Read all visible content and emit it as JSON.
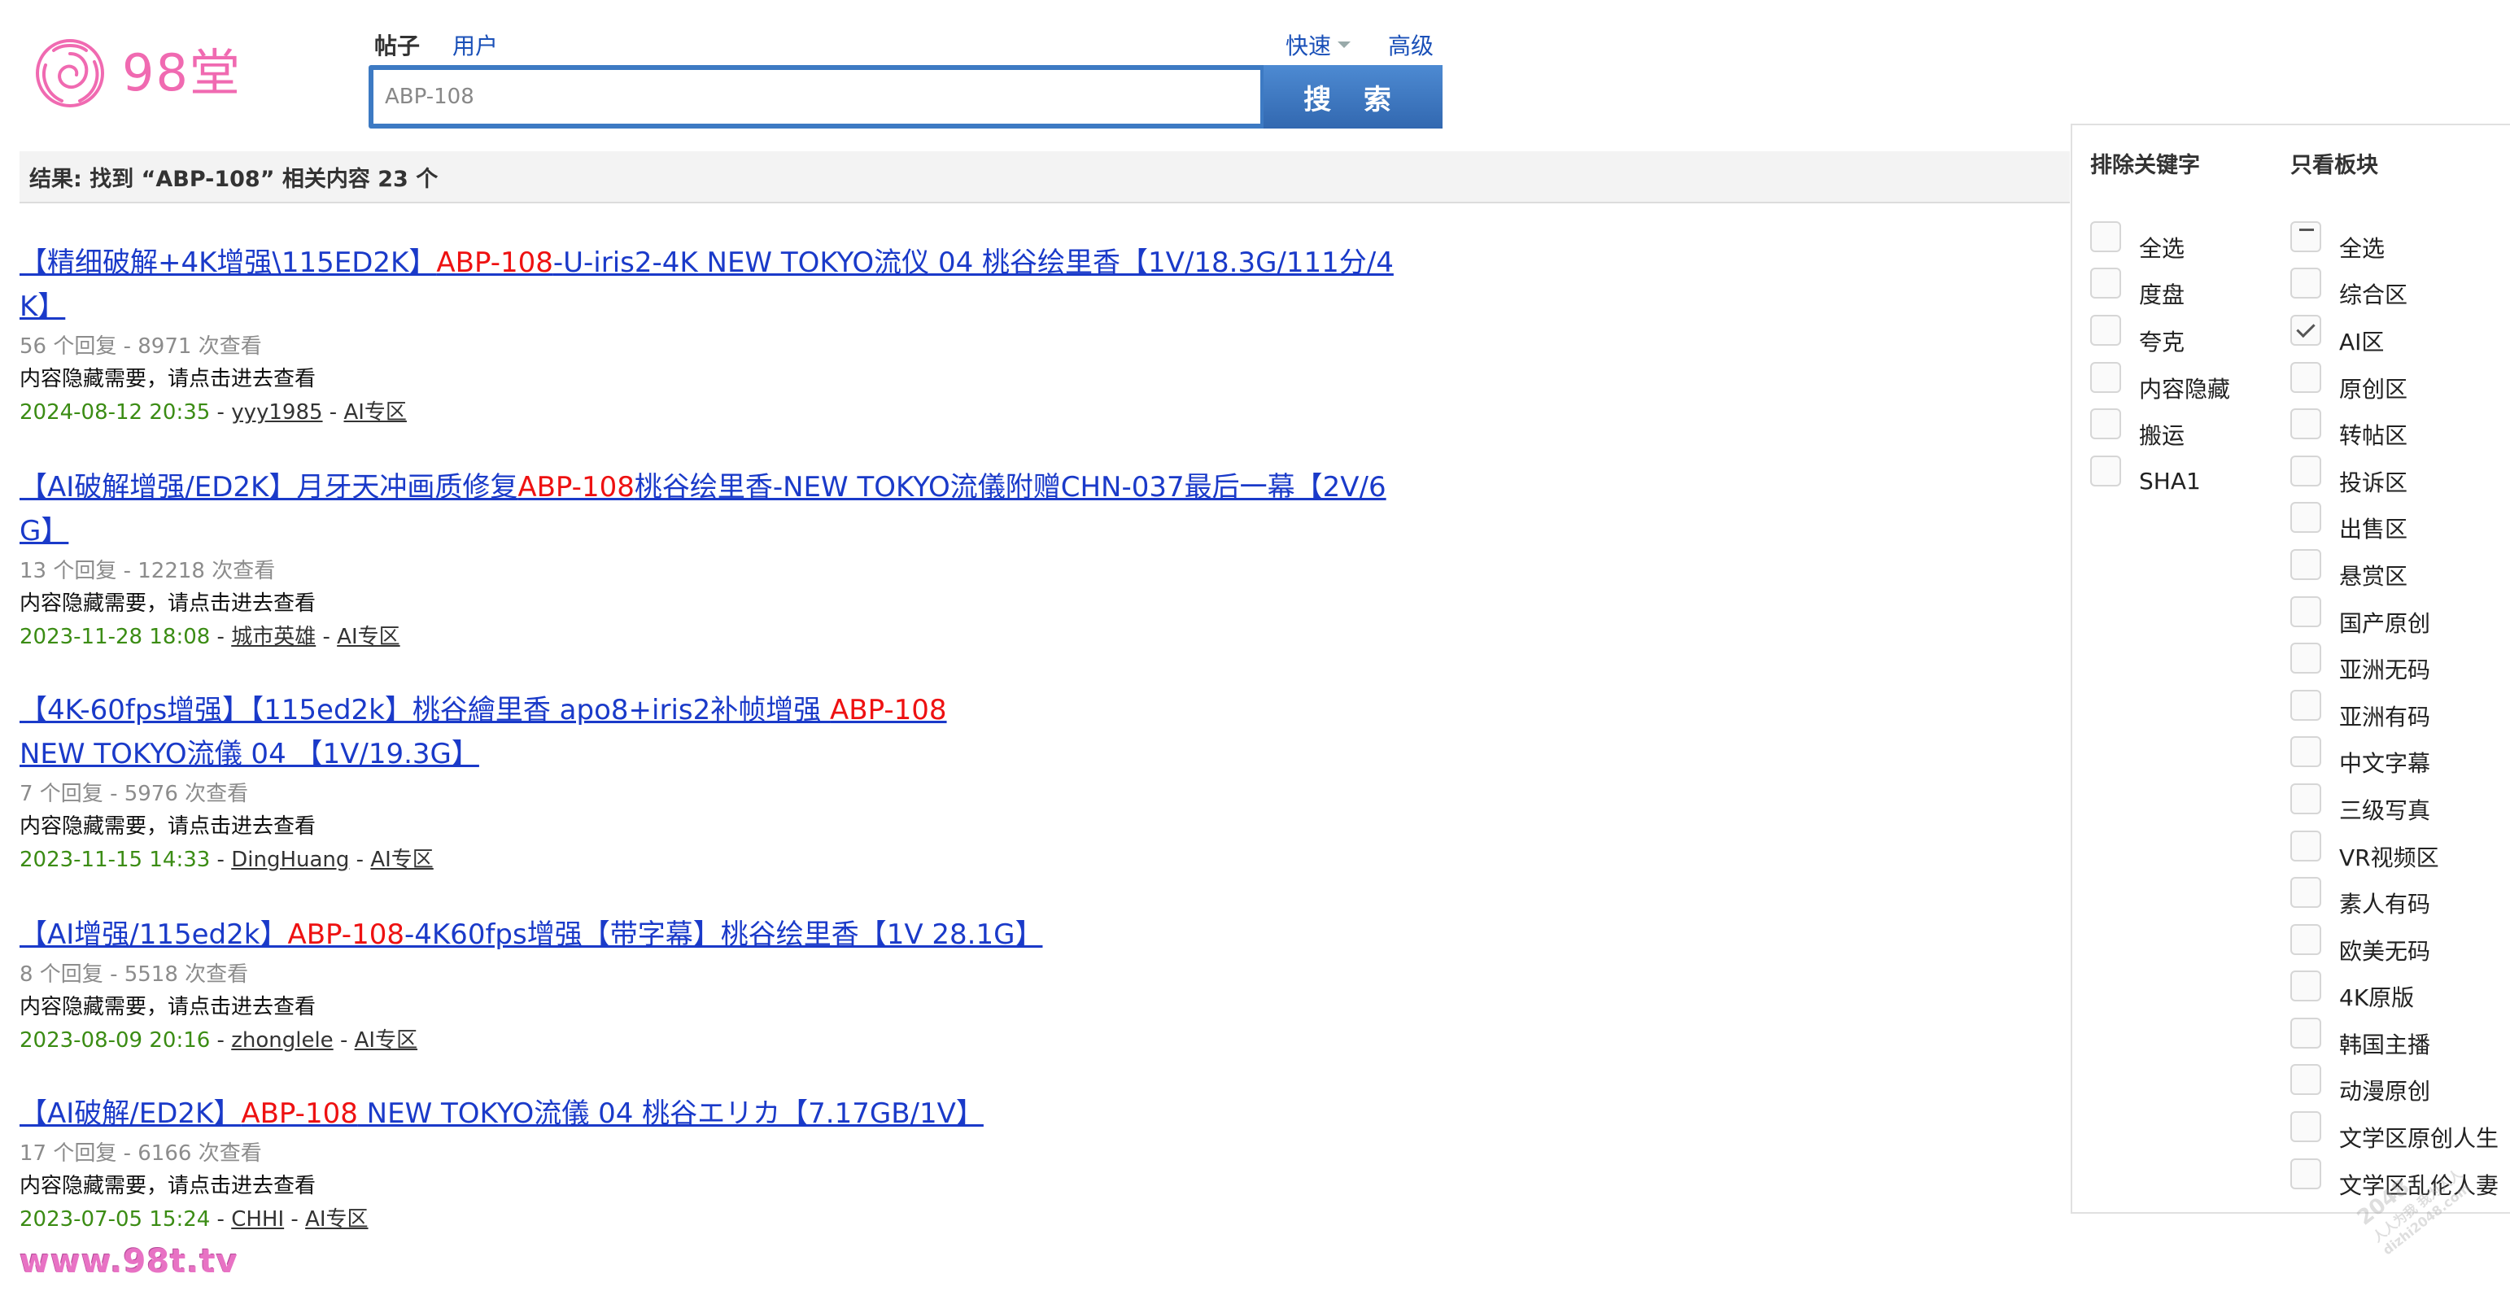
{
  "brand": {
    "logo_text": "98堂"
  },
  "search": {
    "tabs": [
      {
        "label": "帖子",
        "active": true
      },
      {
        "label": "用户",
        "active": false
      }
    ],
    "links": {
      "quick": "快速",
      "advanced": "高级"
    },
    "value": "ABP-108",
    "button_label": "搜 索"
  },
  "results_summary": "结果: 找到 “ABP-108” 相关内容 23 个",
  "results": [
    {
      "title_before": "【精细破解+4K增强\\115ED2K】",
      "title_highlight": "ABP-108",
      "title_after": "-U-iris2-4K NEW TOKYO流仪 04 桃谷绘里香【1V/18.3G/111分/4K】",
      "meta": "56 个回复 - 8971 次查看",
      "description": "内容隐藏需要，请点击进去查看",
      "date": "2024-08-12 20:35",
      "author": "yyy1985",
      "forum": "AI专区"
    },
    {
      "title_before": "【AI破解增强/ED2K】月牙天冲画质修复",
      "title_highlight": "ABP-108",
      "title_after": "桃谷绘里香-NEW TOKYO流儀附赠CHN-037最后一幕【2V/6G】",
      "meta": "13 个回复 - 12218 次查看",
      "description": "内容隐藏需要，请点击进去查看",
      "date": "2023-11-28 18:08",
      "author": "城市英雄",
      "forum": "AI专区"
    },
    {
      "title_before": "【4K-60fps增强】【115ed2k】桃谷繪里香 apo8+iris2补帧增强 ",
      "title_highlight": "ABP-108",
      "title_after": " NEW TOKYO流儀 04 【1V/19.3G】",
      "meta": "7 个回复 - 5976 次查看",
      "description": "内容隐藏需要，请点击进去查看",
      "date": "2023-11-15 14:33",
      "author": "DingHuang",
      "forum": "AI专区"
    },
    {
      "title_before": "【AI增强/115ed2k】",
      "title_highlight": "ABP-108",
      "title_after": "-4K60fps增强【带字幕】桃谷绘里香【1V 28.1G】",
      "meta": "8 个回复 - 5518 次查看",
      "description": "内容隐藏需要，请点击进去查看",
      "date": "2023-08-09 20:16",
      "author": "zhonglele",
      "forum": "AI专区"
    },
    {
      "title_before": "【AI破解/ED2K】",
      "title_highlight": "ABP-108",
      "title_after": " NEW TOKYO流儀 04 桃谷エリカ【7.17GB/1V】",
      "meta": "17 个回复 - 6166 次查看",
      "description": "内容隐藏需要，请点击进去查看",
      "date": "2023-07-05 15:24",
      "author": "CHHI",
      "forum": "AI专区"
    }
  ],
  "filters": {
    "exclude_heading": "排除关键字",
    "exclude_items": [
      {
        "label": "全选",
        "state": "unchecked"
      },
      {
        "label": "度盘",
        "state": "unchecked"
      },
      {
        "label": "夸克",
        "state": "unchecked"
      },
      {
        "label": "内容隐藏",
        "state": "unchecked"
      },
      {
        "label": "搬运",
        "state": "unchecked"
      },
      {
        "label": "SHA1",
        "state": "unchecked"
      }
    ],
    "forum_heading": "只看板块",
    "forum_items": [
      {
        "label": "全选",
        "state": "partial"
      },
      {
        "label": "综合区",
        "state": "unchecked"
      },
      {
        "label": "AI区",
        "state": "checked"
      },
      {
        "label": "原创区",
        "state": "unchecked"
      },
      {
        "label": "转帖区",
        "state": "unchecked"
      },
      {
        "label": "投诉区",
        "state": "unchecked"
      },
      {
        "label": "出售区",
        "state": "unchecked"
      },
      {
        "label": "悬赏区",
        "state": "unchecked"
      },
      {
        "label": "国产原创",
        "state": "unchecked"
      },
      {
        "label": "亚洲无码",
        "state": "unchecked"
      },
      {
        "label": "亚洲有码",
        "state": "unchecked"
      },
      {
        "label": "中文字幕",
        "state": "unchecked"
      },
      {
        "label": "三级写真",
        "state": "unchecked"
      },
      {
        "label": "VR视频区",
        "state": "unchecked"
      },
      {
        "label": "素人有码",
        "state": "unchecked"
      },
      {
        "label": "欧美无码",
        "state": "unchecked"
      },
      {
        "label": "4K原版",
        "state": "unchecked"
      },
      {
        "label": "韩国主播",
        "state": "unchecked"
      },
      {
        "label": "动漫原创",
        "state": "unchecked"
      },
      {
        "label": "文学区原创人生",
        "state": "unchecked"
      },
      {
        "label": "文学区乱伦人妻",
        "state": "unchecked"
      }
    ]
  },
  "watermarks": {
    "bottom_left": "www.98t.tv",
    "bottom_right_lines": [
      "2048",
      "人人为我 我为人人",
      "dizhi2048.com"
    ]
  },
  "colors": {
    "link": "#1a3ac9",
    "highlight": "#e11111",
    "date": "#3b8c14",
    "search_accent": "#3d7ac3",
    "logo": "#f06ab1"
  }
}
